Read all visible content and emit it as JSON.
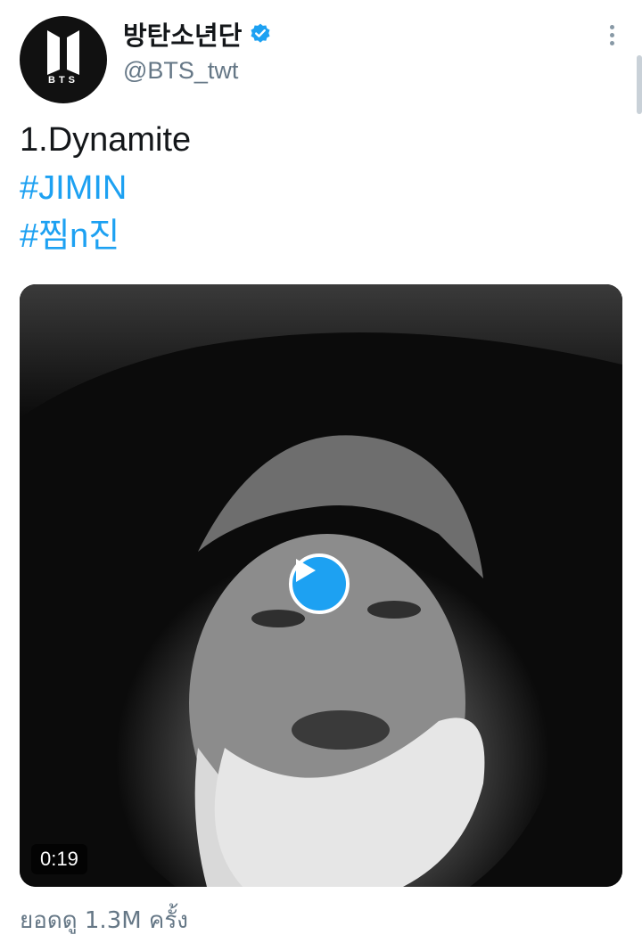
{
  "account": {
    "display_name": "방탄소년단",
    "handle": "@BTS_twt",
    "avatar_caption": "BTS",
    "verified": true
  },
  "tweet": {
    "lines": [
      "1.Dynamite",
      "#JIMIN",
      "#찜n진"
    ]
  },
  "media": {
    "type": "video",
    "duration": "0:19"
  },
  "stats": {
    "views": "ยอดดู 1.3M ครั้ง"
  },
  "colors": {
    "link": "#1da1f2",
    "secondary_text": "#657786",
    "primary_text": "#14171a"
  },
  "icons": {
    "verified": "verified-badge-icon",
    "more": "more-vertical-icon",
    "play": "play-icon"
  }
}
